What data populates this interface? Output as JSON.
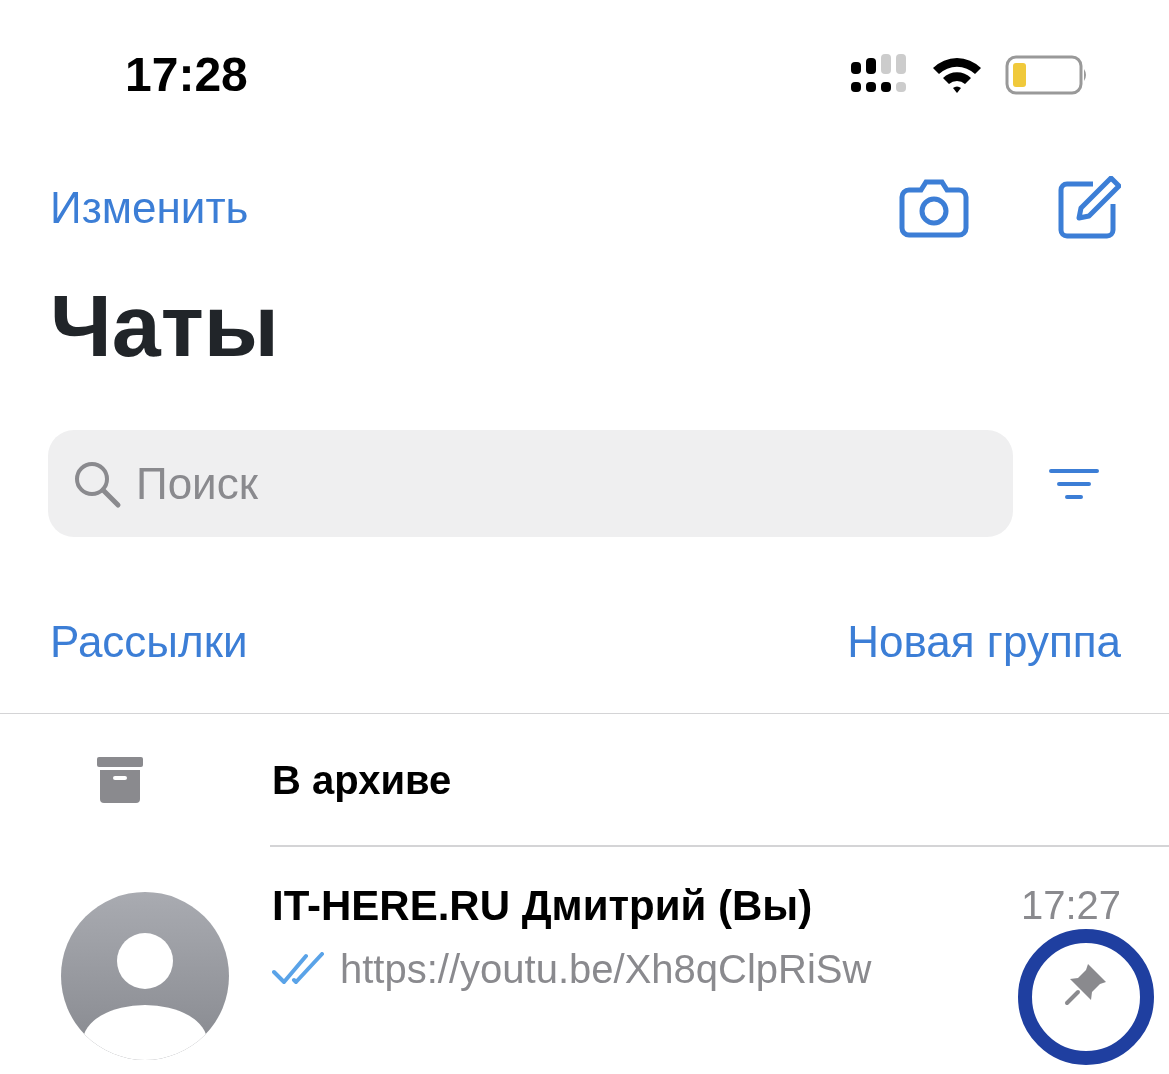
{
  "status_bar": {
    "time": "17:28"
  },
  "nav": {
    "edit_label": "Изменить"
  },
  "title": "Чаты",
  "search": {
    "placeholder": "Поиск"
  },
  "actions": {
    "broadcasts": "Рассылки",
    "new_group": "Новая группа"
  },
  "archive": {
    "label": "В архиве"
  },
  "chats": [
    {
      "name": "IT-HERE.RU Дмитрий (Вы)",
      "time": "17:27",
      "preview": "https://youtu.be/Xh8qClpRiSw",
      "read": true,
      "pinned": true,
      "circled": true
    }
  ]
}
